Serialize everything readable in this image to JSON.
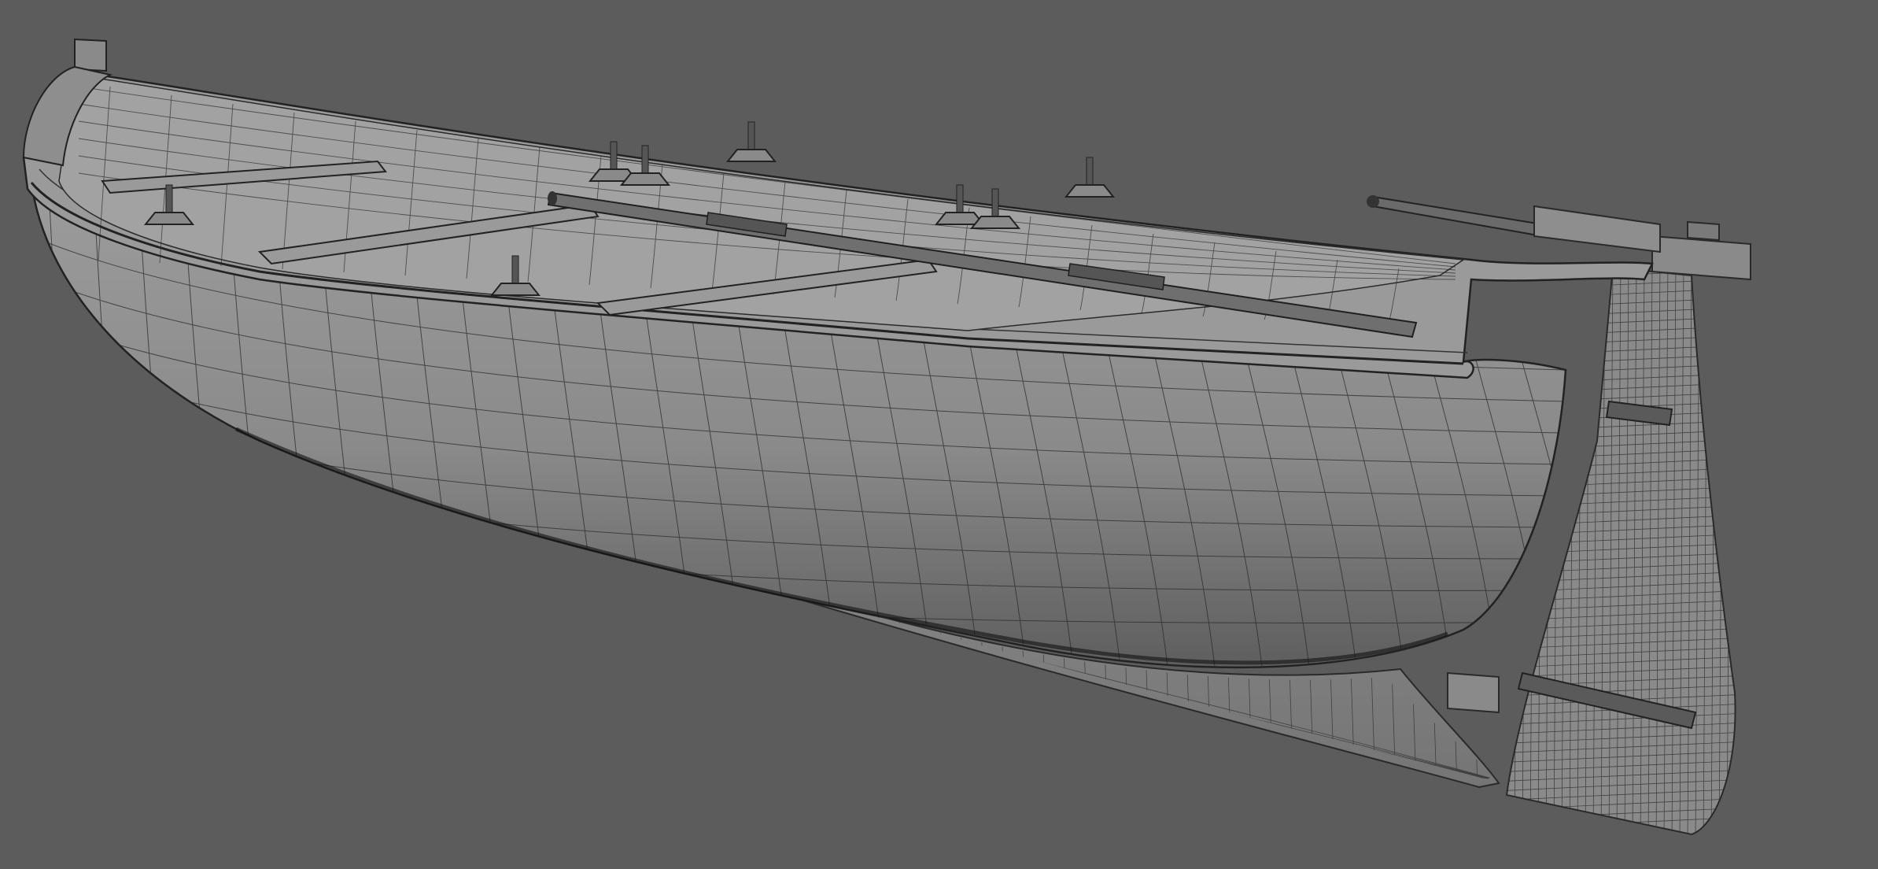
{
  "scene": {
    "subject": "wireframe-boat-model",
    "background_color": "#5c5c5c",
    "hull_color": "#8e8e8e",
    "hull_shadow_color": "#6f6f6f",
    "interior_color": "#9a9a9a",
    "wire_color": "#2a2a2a",
    "keel_color": "#7d7d7d",
    "oar_color": "#6a6a6a"
  }
}
